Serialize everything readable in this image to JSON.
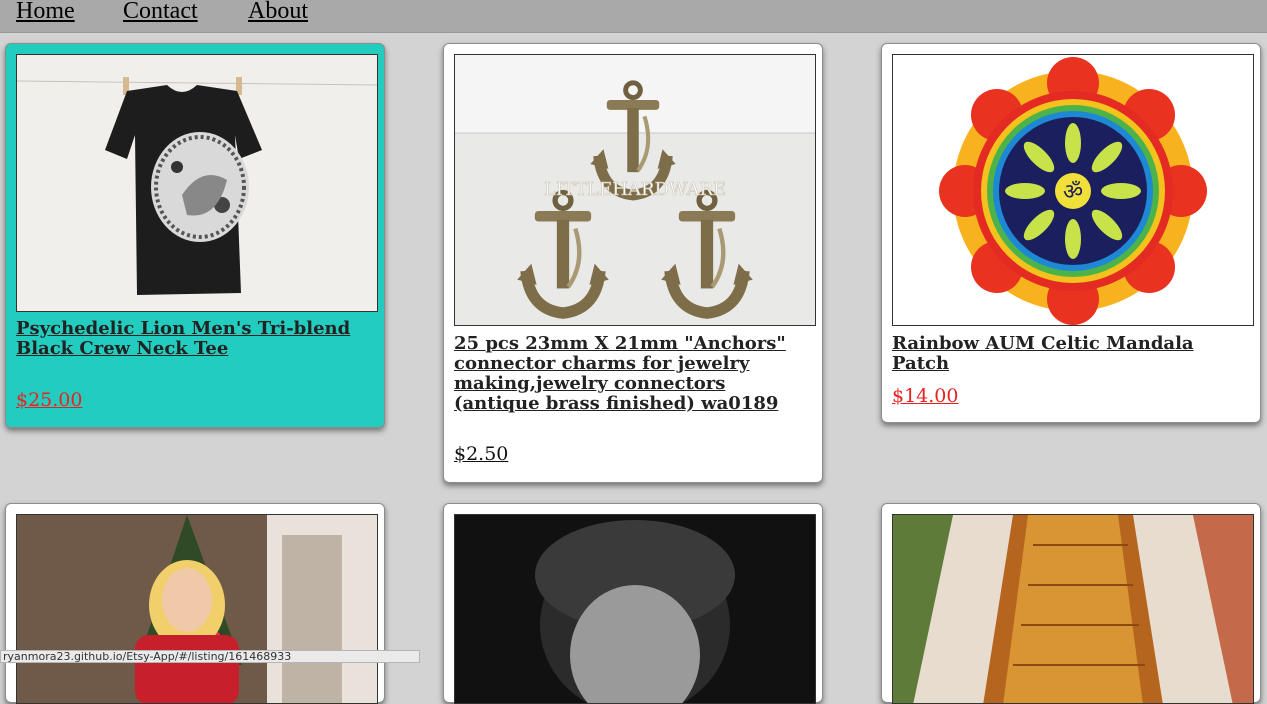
{
  "nav": {
    "home": "Home",
    "contact": "Contact",
    "about": "About"
  },
  "listings": [
    {
      "title": "Psychedelic Lion Men's Tri-blend Black Crew Neck Tee",
      "price": "$25.00",
      "image_icon": "tshirt-image",
      "state": "hover"
    },
    {
      "title": "25 pcs 23mm X 21mm \"Anchors\" connector charms for jewelry making,jewelry connectors (antique brass finished) wa0189",
      "price": "$2.50",
      "image_icon": "anchor-charms-image",
      "watermark": "LITTLEHARDWARE"
    },
    {
      "title": "Rainbow AUM Celtic Mandala Patch",
      "price": "$14.00",
      "image_icon": "mandala-patch-image"
    },
    {
      "title": "",
      "price": "",
      "image_icon": "woman-christmas-tree-image"
    },
    {
      "title": "",
      "price": "",
      "image_icon": "black-white-portrait-image"
    },
    {
      "title": "",
      "price": "",
      "image_icon": "woven-rug-image"
    }
  ],
  "status_url": "ryanmora23.github.io/Etsy-App/#/listing/161468933",
  "colors": {
    "navbar": "#a9a9a9",
    "background": "#d3d3d3",
    "card_hover": "#22cdc0",
    "price_red": "#e8231f"
  }
}
